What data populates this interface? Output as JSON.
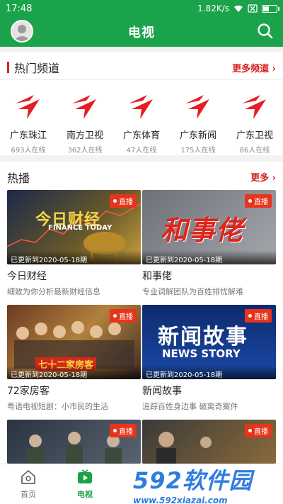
{
  "statusbar": {
    "time": "17:48",
    "speed": "1.82K/s"
  },
  "appbar": {
    "title": "电视"
  },
  "hot_channels": {
    "title": "热门频道",
    "more": "更多频道",
    "items": [
      {
        "name": "广东珠江",
        "count": "693人在线"
      },
      {
        "name": "南方卫视",
        "count": "362人在线"
      },
      {
        "name": "广东体育",
        "count": "47人在线"
      },
      {
        "name": "广东新闻",
        "count": "175人在线"
      },
      {
        "name": "广东卫视",
        "count": "86人在线"
      }
    ]
  },
  "hot_play": {
    "title": "热播",
    "more": "更多",
    "live_label": "直播",
    "cards": [
      {
        "title": "今日财经",
        "desc": "细致为你分析最新财经信息",
        "updated": "已更新到2020-05-18期",
        "thumb_text": "今日财经",
        "thumb_sub": "FINANCE TODAY"
      },
      {
        "title": "和事佬",
        "desc": "专业调解团队为百姓排忧解难",
        "updated": "已更新到2020-05-18期",
        "thumb_text": "和事佬",
        "thumb_sub": ""
      },
      {
        "title": "72家房客",
        "desc": "粤语电视短剧：小市民的生活",
        "updated": "已更新到2020-05-18期",
        "thumb_text": "七十二家房客",
        "thumb_sub": ""
      },
      {
        "title": "新闻故事",
        "desc": "追踪百姓身边事 破离奇案件",
        "updated": "已更新到2020-05-18期",
        "thumb_text": "新闻故事",
        "thumb_sub": "NEWS STORY"
      },
      {
        "title": "",
        "desc": "",
        "updated": "",
        "thumb_text": "",
        "thumb_sub": ""
      },
      {
        "title": "",
        "desc": "",
        "updated": "",
        "thumb_text": "",
        "thumb_sub": ""
      }
    ]
  },
  "tabs": [
    {
      "label": "首页"
    },
    {
      "label": "电视"
    }
  ],
  "watermark": {
    "brand": "592软件园",
    "url": "www.592xiazai.com"
  },
  "colors": {
    "brand_green": "#1aa34a",
    "accent_red": "#d62020",
    "live_red": "#e8341c"
  }
}
